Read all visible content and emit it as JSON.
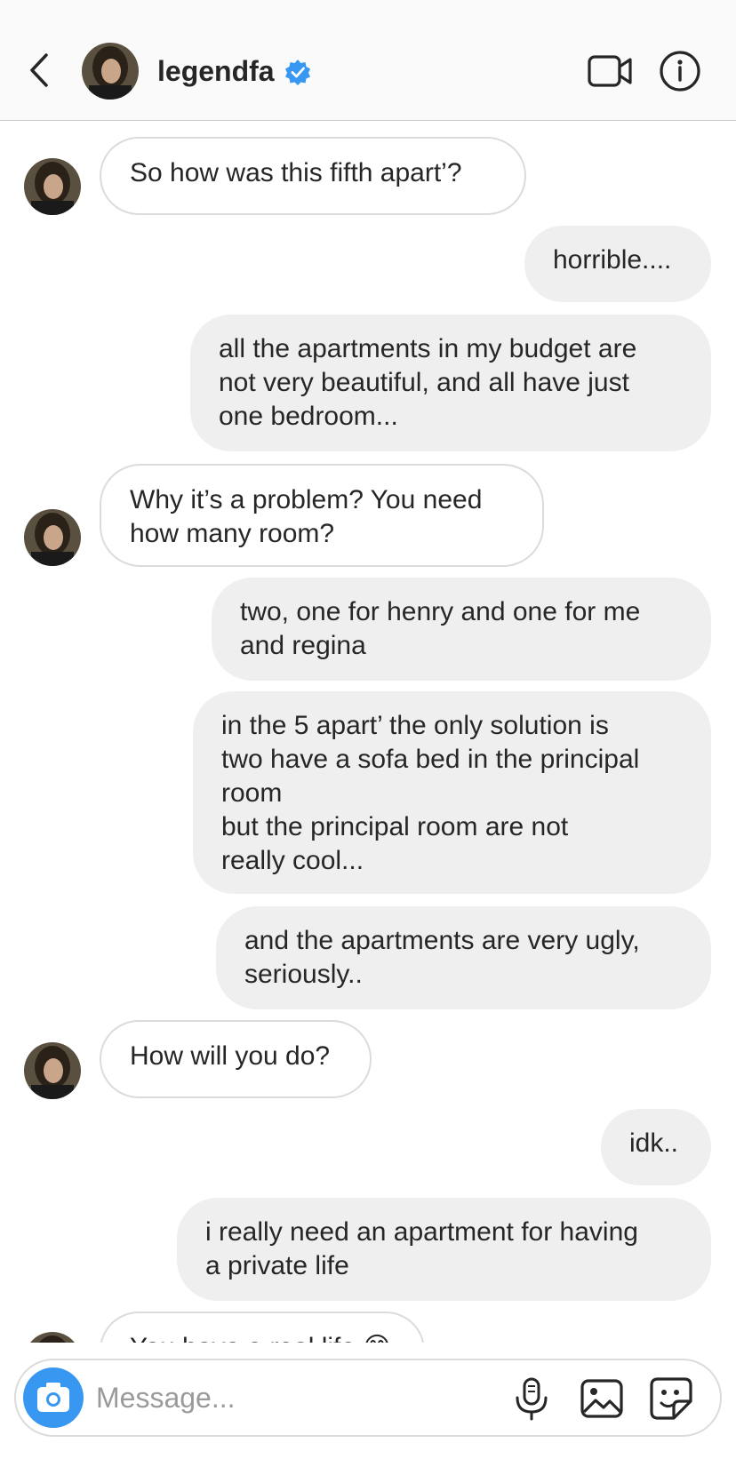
{
  "header": {
    "username": "legendfa",
    "verified_color": "#3897f0"
  },
  "messages": [
    {
      "from": "them",
      "text": "So how was this fifth apart’?"
    },
    {
      "from": "me",
      "text": "horrible...."
    },
    {
      "from": "me",
      "text": "all the apartments in my budget are\nnot very beautiful, and all have just\none bedroom..."
    },
    {
      "from": "them",
      "text": "Why it’s a problem? You need\nhow many room?"
    },
    {
      "from": "me",
      "text": "two, one for henry and one for me\nand regina"
    },
    {
      "from": "me",
      "text": "in the 5 apart’ the only solution is\ntwo have a sofa bed in the principal\nroom\nbut the principal room are not\nreally cool..."
    },
    {
      "from": "me",
      "text": "and the apartments are very ugly,\nseriously.."
    },
    {
      "from": "them",
      "text": "How will you do?"
    },
    {
      "from": "me",
      "text": "idk.."
    },
    {
      "from": "me",
      "text": "i really need an apartment for having\na private life"
    },
    {
      "from": "them",
      "text": "You have a real life 😅"
    }
  ],
  "composer": {
    "placeholder": "Message..."
  },
  "icons": {
    "back": "chevron-left-icon",
    "video": "video-camera-icon",
    "info": "info-icon",
    "camera": "camera-icon",
    "mic": "microphone-icon",
    "gallery": "image-icon",
    "sticker": "sticker-icon"
  },
  "colors": {
    "accent": "#3897f0",
    "incoming_bg": "#ffffff",
    "outgoing_bg": "#efefef"
  }
}
